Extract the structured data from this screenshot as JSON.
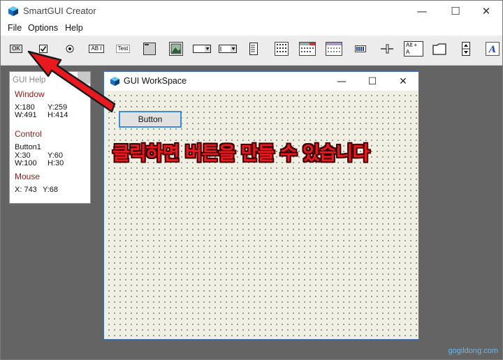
{
  "app": {
    "title": "SmartGUI Creator"
  },
  "menu": [
    "File",
    "Options",
    "Help"
  ],
  "toolbar": {
    "ok_label": "OK",
    "edit_label": "AB I",
    "text_label": "Test",
    "hotkey_label": "Alt + A"
  },
  "workspace": {
    "title": "GUI WorkSpace",
    "button_label": "Button"
  },
  "help_panel": {
    "title": "GUI Help",
    "window_heading": "Window",
    "window_x": "X:180",
    "window_y": "Y:259",
    "window_w": "W:491",
    "window_h": "H:414",
    "control_heading": "Control",
    "control_name": "Button1",
    "control_x": "X:30",
    "control_y": "Y:60",
    "control_w": "W:100",
    "control_h": "H:30",
    "mouse_heading": "Mouse",
    "mouse_x": "X: 743",
    "mouse_y": "Y:68"
  },
  "annotation": "클릭하면 버튼을 만들 수 있습니다",
  "watermark": "gogildong.com",
  "colors": {
    "annotation": "#e8191f",
    "arrow": "#e8191f",
    "workspace_border": "#3c73b5",
    "section_heading": "#8b1a1a"
  }
}
